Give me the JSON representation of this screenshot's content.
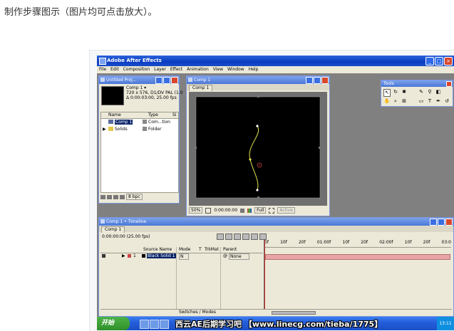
{
  "caption": "制作步骤图示（图片均可点击放大）。",
  "app": {
    "title": "Adobe After Effects"
  },
  "menu": [
    "File",
    "Edit",
    "Composition",
    "Layer",
    "Effect",
    "Animation",
    "View",
    "Window",
    "Help"
  ],
  "project": {
    "title": "Untitled Proj...",
    "comp_name": "Comp 1 ▾",
    "comp_info_1": "720 x 576, D1/DV PAL (1.0",
    "comp_info_2": "Δ 0:00:03:00, 25.00 fps",
    "columns": [
      "Name",
      "Type",
      "Si"
    ],
    "items": [
      {
        "name": "Comp 1",
        "type": "Com...tion"
      },
      {
        "name": "Solids",
        "type": "Folder"
      }
    ],
    "bpc": "8 bpc"
  },
  "comp": {
    "title": "Comp 1",
    "tab": "Comp 1",
    "zoom": "50%",
    "time": "0:00:00:00",
    "resolution": "Full",
    "camera": "Active"
  },
  "tools": {
    "title": "Tools"
  },
  "timeline": {
    "title": "Comp 1 • Timeline",
    "tab": "Comp 1",
    "timecode": "0:00:00:00 (25.00 fps)",
    "columns": [
      "Source Name",
      "Mode",
      "T",
      "TrkMat",
      "Parent"
    ],
    "layer": {
      "index": "1",
      "name": "Black Solid 1",
      "mode": "N",
      "parent": "None"
    },
    "ruler": [
      "0f",
      "10f",
      "20f",
      "01:00f",
      "10f",
      "20f",
      "02:00f",
      "10f",
      "20f",
      "03:0"
    ],
    "switches": "Switches / Modes"
  },
  "taskbar": {
    "start": "开始",
    "watermark": "西云AE后期学习吧 【www.linecg.com/tieba/1775】",
    "clock": "13:11"
  },
  "colors": {
    "xp_blue": "#0a3cc2",
    "panel_bg": "#ece9d8",
    "canvas": "#000000",
    "path": "#e0e050",
    "layer_bar": "#e9a5a5"
  }
}
